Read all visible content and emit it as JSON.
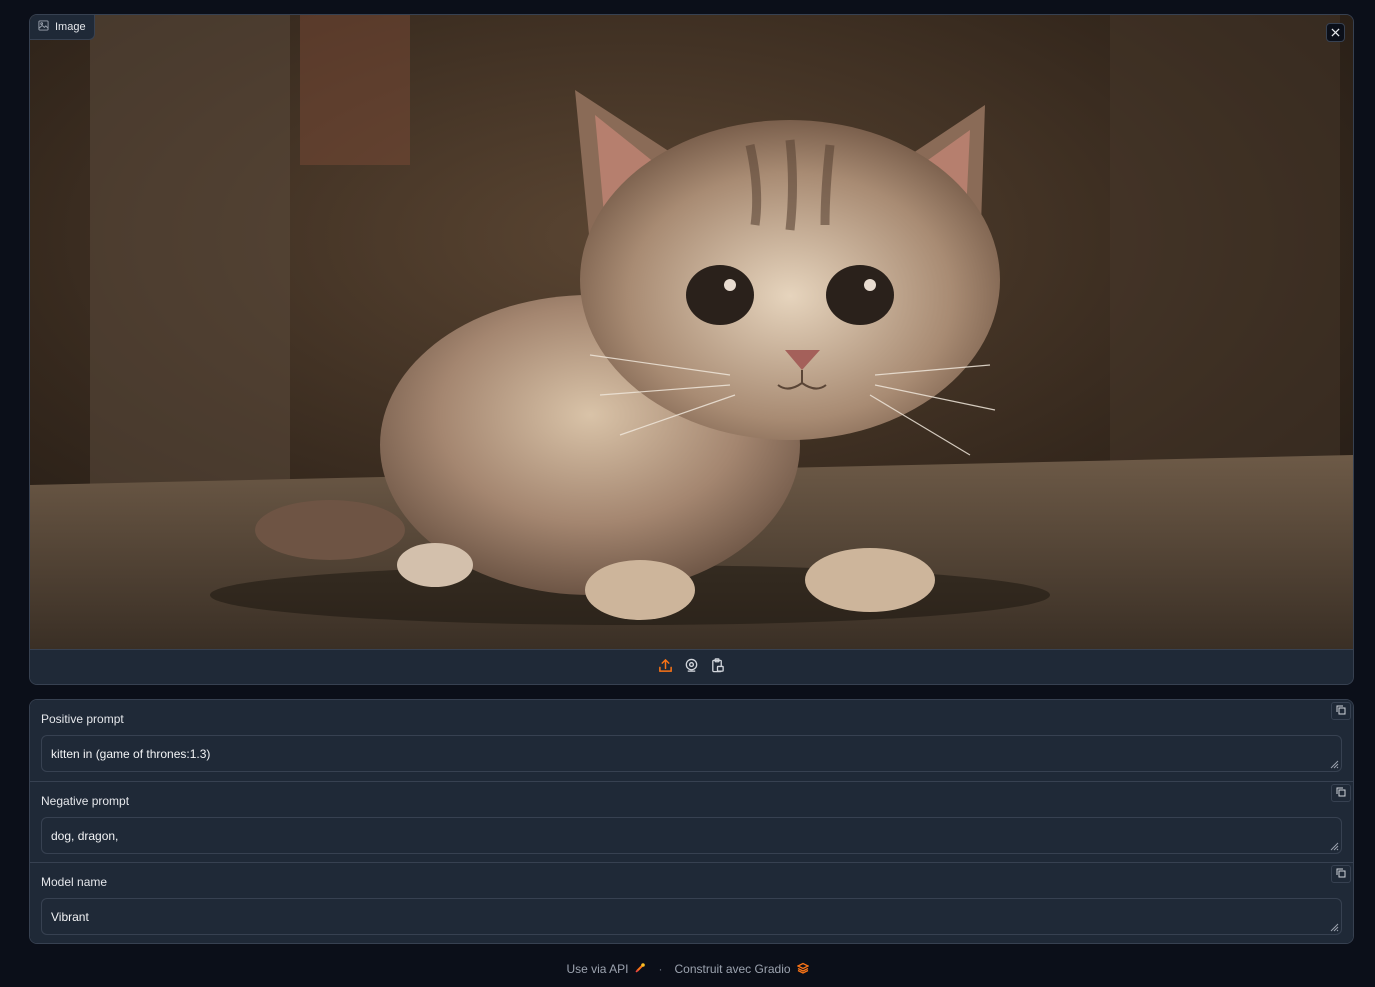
{
  "image_panel": {
    "label": "Image",
    "label_icon": "image-icon",
    "clear_icon": "close-icon",
    "source_icons": [
      "upload-icon",
      "webcam-icon",
      "clipboard-icon"
    ],
    "accent": "#f97316"
  },
  "fields": [
    {
      "label": "Positive prompt",
      "value": "kitten in (game of thrones:1.3)"
    },
    {
      "label": "Negative prompt",
      "value": "dog, dragon,"
    },
    {
      "label": "Model name",
      "value": "Vibrant"
    }
  ],
  "footer": {
    "api_label": "Use via API",
    "separator": "·",
    "built_label": "Construit avec Gradio"
  },
  "colors": {
    "background": "#0b0f19",
    "panel": "#1f2937",
    "border": "#374151",
    "accent": "#f97316"
  }
}
